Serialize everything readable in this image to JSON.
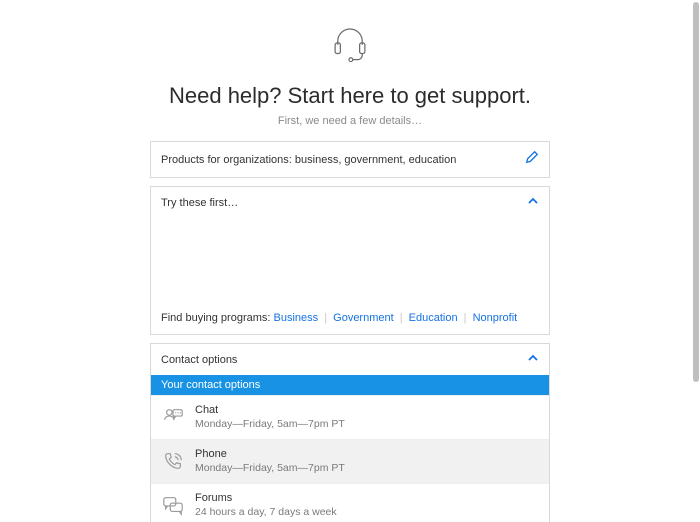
{
  "header": {
    "title": "Need help? Start here to get support.",
    "subtitle": "First, we need a few details…"
  },
  "product": {
    "label": "Products for organizations: business, government, education"
  },
  "try": {
    "header": "Try these first…",
    "buying_prefix": "Find buying programs:",
    "links": {
      "business": "Business",
      "government": "Government",
      "education": "Education",
      "nonprofit": "Nonprofit"
    }
  },
  "contact": {
    "header": "Contact options",
    "banner": "Your contact options",
    "options": [
      {
        "title": "Chat",
        "sub": "Monday—Friday, 5am—7pm PT"
      },
      {
        "title": "Phone",
        "sub": "Monday—Friday, 5am—7pm PT"
      },
      {
        "title": "Forums",
        "sub": "24 hours a day, 7 days a week"
      }
    ]
  }
}
